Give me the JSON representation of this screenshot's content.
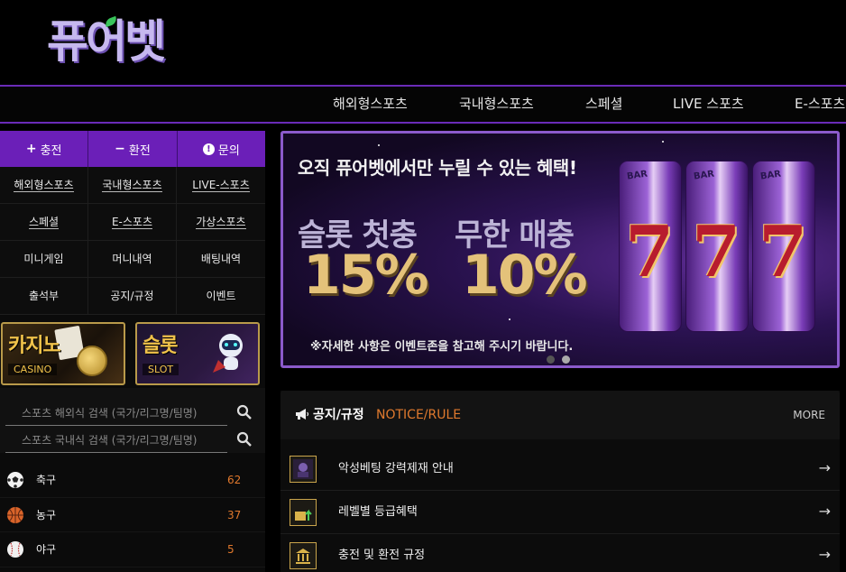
{
  "header": {
    "logo_text": "퓨어벳"
  },
  "topnav": {
    "items": [
      "해외형스포츠",
      "국내형스포츠",
      "스페셜",
      "LIVE 스포츠",
      "E-스포츠"
    ]
  },
  "left": {
    "action_tabs": [
      {
        "icon": "plus-icon",
        "symbol": "+",
        "label": "충전"
      },
      {
        "icon": "minus-icon",
        "symbol": "−",
        "label": "환전"
      },
      {
        "icon": "info-icon",
        "symbol": "!",
        "label": "문의"
      }
    ],
    "menu": [
      "해외형스포츠",
      "국내형스포츠",
      "LIVE-스포츠",
      "스페셜",
      "E-스포츠",
      "가상스포츠",
      "미니게임",
      "머니내역",
      "배팅내역",
      "출석부",
      "공지/규정",
      "이벤트"
    ],
    "game_banners": [
      {
        "title": "카지노",
        "subtitle": "CASINO"
      },
      {
        "title": "슬롯",
        "subtitle": "SLOT"
      }
    ],
    "search": {
      "overseas_placeholder": "스포츠 해외식 검색 (국가/리그명/팀명)",
      "domestic_placeholder": "스포츠 국내식 검색 (국가/리그명/팀명)"
    },
    "sports": [
      {
        "name": "축구",
        "count": "62",
        "icon": "soccer-ball-icon"
      },
      {
        "name": "농구",
        "count": "37",
        "icon": "basketball-icon"
      },
      {
        "name": "야구",
        "count": "5",
        "icon": "baseball-icon"
      }
    ]
  },
  "hero": {
    "headline": "오직 퓨어벳에서만 누릴 수 있는 혜택!",
    "label_1": "슬롯 첫충",
    "label_2": "무한 매충",
    "percent_1": "15%",
    "percent_2": "10%",
    "note": "※자세한 사항은 이벤트존을 참고해 주시기 바랍니다.",
    "reel_text": "BAR",
    "reel_symbol": "7",
    "slides_total": 2,
    "active_slide": 2
  },
  "notice": {
    "title": "공지/규정",
    "title_en": "NOTICE/RULE",
    "more": "MORE",
    "items": [
      {
        "text": "악성베팅 강력제재 안내"
      },
      {
        "text": "레벨별 등급혜택"
      },
      {
        "text": "충전 및 환전 규정"
      }
    ]
  },
  "colors": {
    "accent_purple": "#6b1fb8",
    "count_orange": "#e0782c",
    "gold": "#e4c27a"
  }
}
